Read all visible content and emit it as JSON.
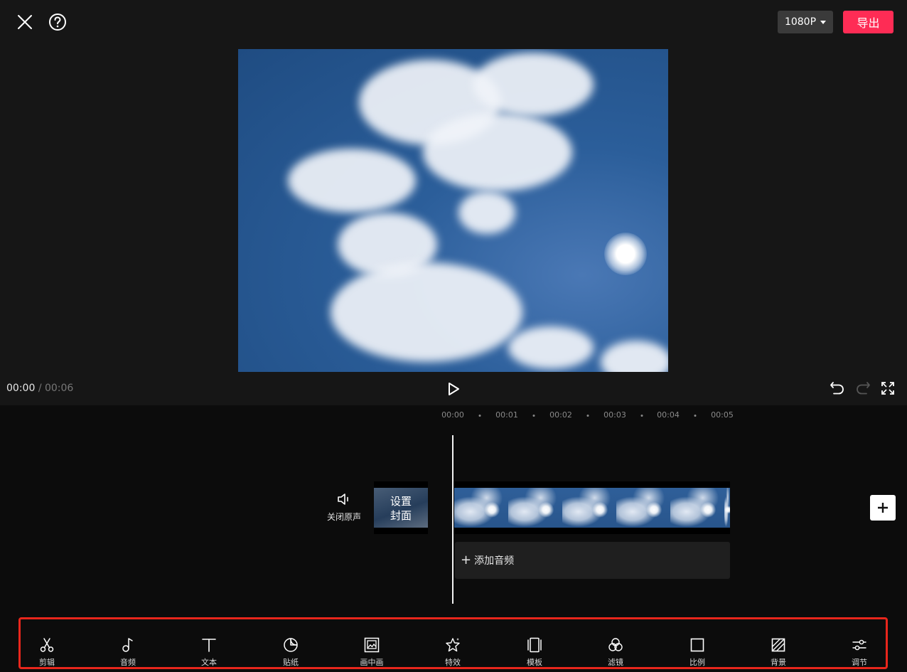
{
  "header": {
    "close_icon": "close-icon",
    "help_icon": "help-icon",
    "resolution": "1080P",
    "export_label": "导出",
    "export_color": "#fe2c55"
  },
  "player": {
    "current_time": "00:00",
    "separator": "/",
    "total_time": "00:06",
    "play_icon": "play-icon",
    "undo_icon": "undo-icon",
    "redo_icon": "redo-icon",
    "fullscreen_icon": "fullscreen-icon"
  },
  "timeline": {
    "ticks": [
      "00:00",
      "00:01",
      "00:02",
      "00:03",
      "00:04",
      "00:05"
    ],
    "mute_label": "关闭原声",
    "cover_line1": "设置",
    "cover_line2": "封面",
    "add_audio_plus": "+",
    "add_audio_label": "添加音频",
    "add_clip_icon": "plus-icon"
  },
  "toolbar": {
    "highlight_color": "#e8261c",
    "tools": [
      {
        "label": "剪辑",
        "icon": "scissors-icon"
      },
      {
        "label": "音频",
        "icon": "music-note-icon"
      },
      {
        "label": "文本",
        "icon": "text-icon"
      },
      {
        "label": "贴纸",
        "icon": "sticker-icon"
      },
      {
        "label": "画中画",
        "icon": "picture-in-picture-icon"
      },
      {
        "label": "特效",
        "icon": "effects-star-icon"
      },
      {
        "label": "模板",
        "icon": "template-icon"
      },
      {
        "label": "滤镜",
        "icon": "filter-icon"
      },
      {
        "label": "比例",
        "icon": "ratio-icon"
      },
      {
        "label": "背景",
        "icon": "background-icon"
      },
      {
        "label": "调节",
        "icon": "adjust-icon"
      }
    ]
  }
}
